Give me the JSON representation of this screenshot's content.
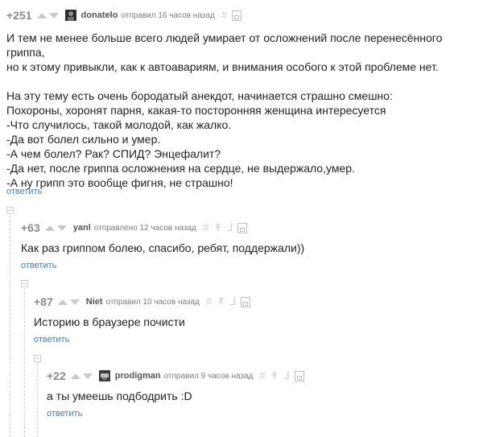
{
  "comments": [
    {
      "rating": "+251",
      "author": "donatelo",
      "meta": "отправил 16 часов назад",
      "avatar": "photo-avatar",
      "text": [
        "И тем не менее больше всего людей умирает от осложнений после перенесённого гриппа,",
        "но к этому привыкли, как к автоавариям, и внимания особого к этой проблеме нет.",
        "",
        "На эту тему есть очень бородатый анекдот, начинается страшно смешно:",
        "Похороны, хоронят парня, какая-то посторонняя женщина интересуется",
        "-Что случилось, такой молодой, как жалко.",
        "-Да вот болел сильно и умер.",
        "-А чем болел? Рак? СПИД? Энцефалит?",
        "-Да нет, после гриппа осложнения на сердце, не выдержало,умер.",
        "-А ну грипп это вообще фигня, не страшно!"
      ],
      "reply": "ответить"
    },
    {
      "rating": "+63",
      "author": "yanl",
      "meta": "отправлено 12 часов назад",
      "avatar": "",
      "text": [
        "Как раз гриппом болею, спасибо, ребят, поддержали))"
      ],
      "reply": "ответить"
    },
    {
      "rating": "+87",
      "author": "Niet",
      "meta": "отправил 10 часов назад",
      "avatar": "",
      "text": [
        "Историю в браузере почисти"
      ],
      "reply": "ответить"
    },
    {
      "rating": "+22",
      "author": "prodigman",
      "meta": "отправил 9 часов назад",
      "avatar": "game-avatar",
      "text": [
        "а ты умеешь подбодрить :D"
      ],
      "reply": "ответить"
    }
  ],
  "icons": {
    "upvote": "arrow-up-icon",
    "downvote": "arrow-down-icon",
    "link": "hash-icon",
    "save": "save-icon",
    "parent": "arrow-up-pin-icon",
    "branch": "branch-icon",
    "collapse": "collapse-icon"
  },
  "colors": {
    "rating": "#8a8a8a",
    "link": "#4a78b8",
    "text": "#222222",
    "meta": "#7d7d7d"
  }
}
